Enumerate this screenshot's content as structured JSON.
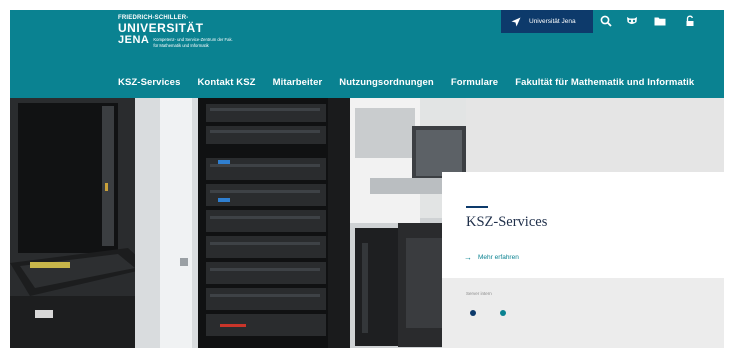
{
  "logo": {
    "line1": "FRIEDRICH-SCHILLER-",
    "line2": "UNIVERSITÄT",
    "line3": "JENA",
    "subtitle_line1": "Kompetenz- und Service-Zentrum der Fak.",
    "subtitle_line2": "für Mathematik und Informatik"
  },
  "topbar": {
    "uni_button_label": "Universität Jena",
    "tools": [
      "search-icon",
      "owl-icon",
      "folder-icon",
      "lock-icon"
    ]
  },
  "nav": {
    "items": [
      {
        "label": "KSZ-Services"
      },
      {
        "label": "Kontakt KSZ"
      },
      {
        "label": "Mitarbeiter"
      },
      {
        "label": "Nutzungsordnungen"
      },
      {
        "label": "Formulare"
      },
      {
        "label": "Fakultät für Mathematik und Informatik"
      }
    ]
  },
  "hero": {
    "card": {
      "title": "KSZ-Services",
      "link_label": "Mehr erfahren",
      "meta_text": "Server intern"
    },
    "slider": {
      "slide_count": 2,
      "active_slide": 1
    }
  },
  "colors": {
    "header_bg": "#0a8291",
    "uni_button_bg": "#0d3a6b",
    "accent": "#0a8291",
    "card_title": "#1f2f4a"
  }
}
